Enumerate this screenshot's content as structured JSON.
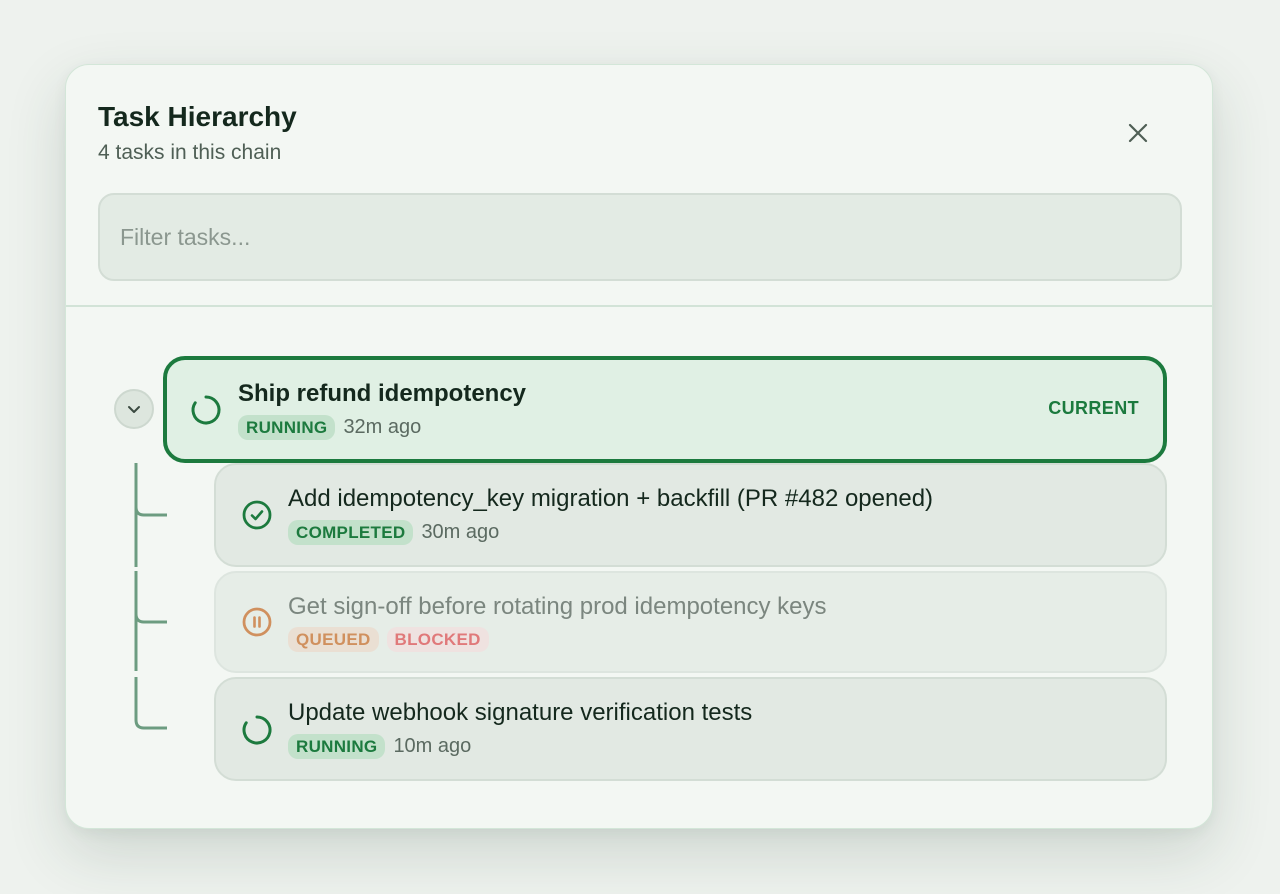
{
  "header": {
    "title": "Task Hierarchy",
    "subtitle": "4 tasks in this chain"
  },
  "filter": {
    "placeholder": "Filter tasks...",
    "value": ""
  },
  "icons": {
    "close": "close-icon",
    "collapse": "chevron-down-icon",
    "running": "spinner-icon",
    "completed": "check-circle-icon",
    "queued": "pause-circle-icon"
  },
  "colors": {
    "accent": "#1c7a3e",
    "queued": "#d0905e",
    "blocked": "#e0797a"
  },
  "root_task": {
    "title": "Ship refund idempotency",
    "status": "RUNNING",
    "time": "32m ago",
    "current_label": "CURRENT"
  },
  "child_tasks": [
    {
      "title": "Add idempotency_key migration + backfill (PR #482 opened)",
      "status": "COMPLETED",
      "time": "30m ago"
    },
    {
      "title": "Get sign-off before rotating prod idempotency keys",
      "status": "QUEUED",
      "flag": "BLOCKED"
    },
    {
      "title": "Update webhook signature verification tests",
      "status": "RUNNING",
      "time": "10m ago"
    }
  ]
}
